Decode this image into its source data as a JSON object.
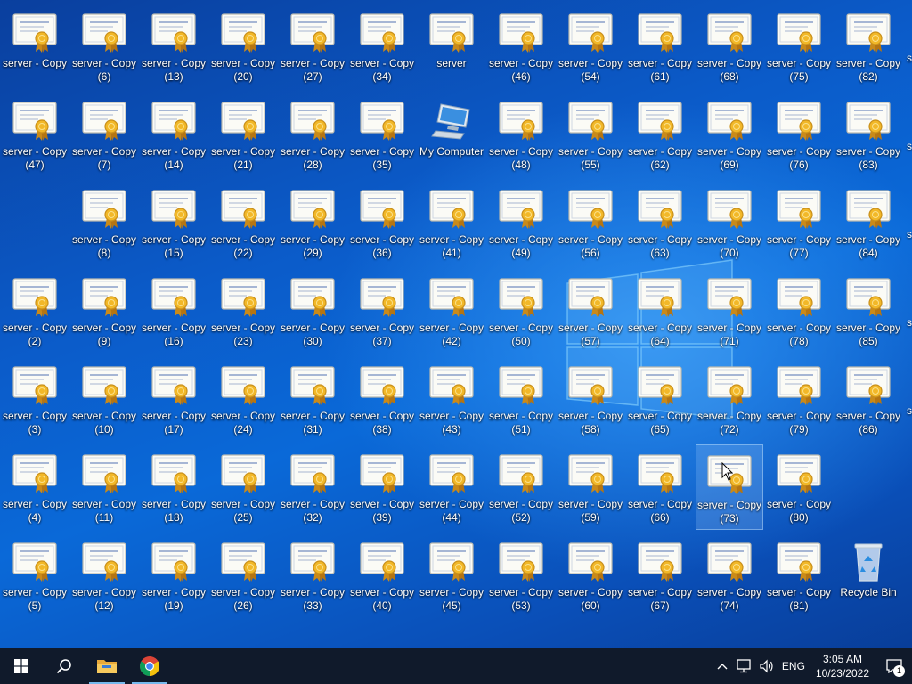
{
  "desktop": {
    "icon_names": {
      "certificate": "certificate-icon",
      "computer": "computer-icon",
      "recycle": "recycle-bin-icon"
    },
    "columns": [
      [
        "server - Copy",
        "server - Copy (47)",
        null,
        "server - Copy (2)",
        "server - Copy (3)",
        "server - Copy (4)",
        "server - Copy (5)"
      ],
      [
        "server - Copy (6)",
        "server - Copy (7)",
        "server - Copy (8)",
        "server - Copy (9)",
        "server - Copy (10)",
        "server - Copy (11)",
        "server - Copy (12)"
      ],
      [
        "server - Copy (13)",
        "server - Copy (14)",
        "server - Copy (15)",
        "server - Copy (16)",
        "server - Copy (17)",
        "server - Copy (18)",
        "server - Copy (19)"
      ],
      [
        "server - Copy (20)",
        "server - Copy (21)",
        "server - Copy (22)",
        "server - Copy (23)",
        "server - Copy (24)",
        "server - Copy (25)",
        "server - Copy (26)"
      ],
      [
        "server - Copy (27)",
        "server - Copy (28)",
        "server - Copy (29)",
        "server - Copy (30)",
        "server - Copy (31)",
        "server - Copy (32)",
        "server - Copy (33)"
      ],
      [
        "server - Copy (34)",
        "server - Copy (35)",
        "server - Copy (36)",
        "server - Copy (37)",
        "server - Copy (38)",
        "server - Copy (39)",
        "server - Copy (40)"
      ],
      [
        "server",
        "My Computer",
        "server - Copy (41)",
        "server - Copy (42)",
        "server - Copy (43)",
        "server - Copy (44)",
        "server - Copy (45)"
      ],
      [
        "server - Copy (46)",
        "server - Copy (48)",
        "server - Copy (49)",
        "server - Copy (50)",
        "server - Copy (51)",
        "server - Copy (52)",
        "server - Copy (53)"
      ],
      [
        "server - Copy (54)",
        "server - Copy (55)",
        "server - Copy (56)",
        "server - Copy (57)",
        "server - Copy (58)",
        "server - Copy (59)",
        "server - Copy (60)"
      ],
      [
        "server - Copy (61)",
        "server - Copy (62)",
        "server - Copy (63)",
        "server - Copy (64)",
        "server - Copy (65)",
        "server - Copy (66)",
        "server - Copy (67)"
      ],
      [
        "server - Copy (68)",
        "server - Copy (69)",
        "server - Copy (70)",
        "server - Copy (71)",
        "server - Copy (72)",
        "server - Copy (73)",
        "server - Copy (74)"
      ],
      [
        "server - Copy (75)",
        "server - Copy (76)",
        "server - Copy (77)",
        "server - Copy (78)",
        "server - Copy (79)",
        "server - Copy (80)",
        "server - Copy (81)"
      ],
      [
        "server - Copy (82)",
        "server - Copy (83)",
        "server - Copy (84)",
        "server - Copy (85)",
        "server - Copy (86)",
        null,
        "Recycle Bin"
      ]
    ],
    "selected": "server - Copy (73)",
    "edge_fragment": "s"
  },
  "taskbar": {
    "items": [
      {
        "name": "start-button",
        "icon": "windows-logo-icon"
      },
      {
        "name": "search-button",
        "icon": "search-icon"
      },
      {
        "name": "file-explorer-button",
        "icon": "folder-icon",
        "active": true
      },
      {
        "name": "chrome-button",
        "icon": "chrome-icon",
        "active": true
      }
    ],
    "tray": {
      "language": "ENG",
      "time": "3:05 AM",
      "date": "10/23/2022",
      "notification_count": "1"
    }
  },
  "colors": {
    "taskbar": "#101a2b",
    "accent": "#76b9ed"
  }
}
